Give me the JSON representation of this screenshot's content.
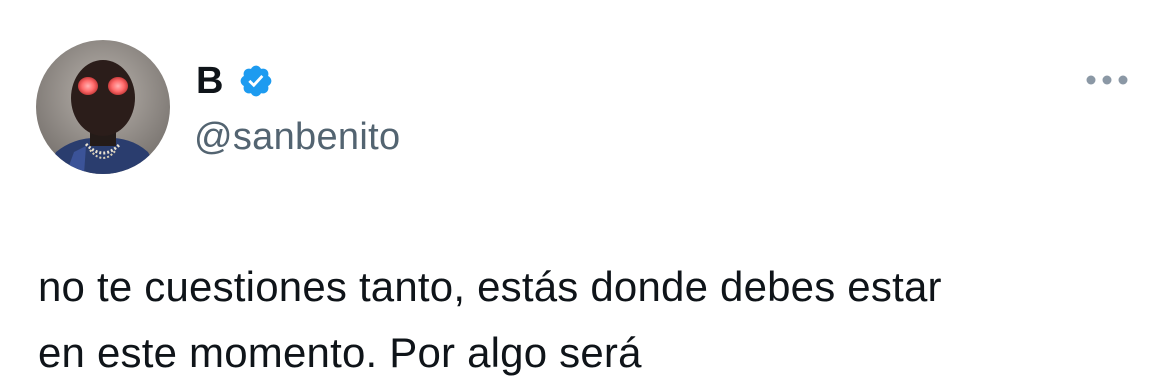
{
  "author": {
    "display_name": "B",
    "handle": "@sanbenito",
    "verified": true,
    "avatar_icon": "masked-person-avatar"
  },
  "tweet": {
    "lines": [
      "no te cuestiones tanto, estás donde debes estar",
      "en este momento. Por algo será"
    ]
  },
  "icons": {
    "verified": "verified-badge-icon",
    "more": "more-options-icon"
  },
  "colors": {
    "text": "#0f1419",
    "secondary_text": "#536471",
    "verified_blue": "#1d9bf0",
    "background": "#ffffff"
  }
}
